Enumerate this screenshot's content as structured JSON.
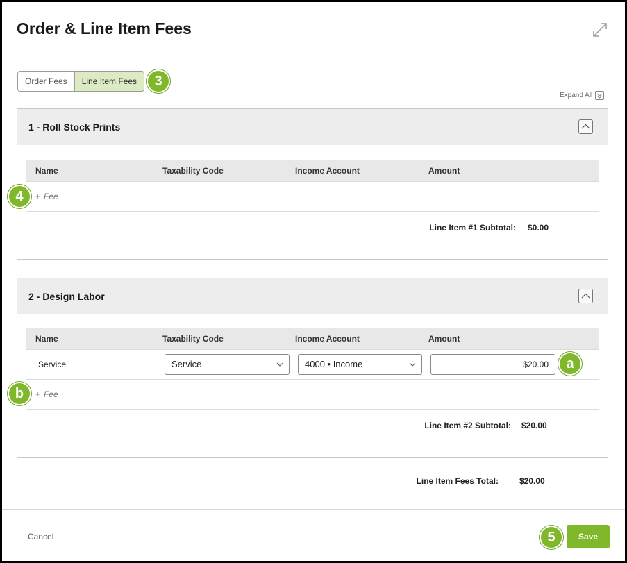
{
  "dialog": {
    "title": "Order & Line Item Fees"
  },
  "tabs": {
    "order_fees": "Order Fees",
    "line_item_fees": "Line Item Fees",
    "active": "Line Item Fees"
  },
  "expand_all": "Expand All",
  "callouts": {
    "tabs": "3",
    "add_fee_1": "4",
    "amount": "a",
    "add_fee_2": "b",
    "save": "5"
  },
  "columns": [
    "Name",
    "Taxability Code",
    "Income Account",
    "Amount"
  ],
  "line_items": [
    {
      "title": "1 - Roll Stock Prints",
      "rows": [],
      "add_fee_label": "Fee",
      "subtotal_label": "Line Item #1 Subtotal:",
      "subtotal_value": "$0.00"
    },
    {
      "title": "2 - Design Labor",
      "rows": [
        {
          "name": "Service",
          "taxability_code": "Service",
          "income_account": "4000 • Income",
          "amount": "$20.00"
        }
      ],
      "add_fee_label": "Fee",
      "subtotal_label": "Line Item #2 Subtotal:",
      "subtotal_value": "$20.00"
    }
  ],
  "total": {
    "label": "Line Item Fees Total:",
    "value": "$20.00"
  },
  "footer": {
    "cancel_label": "Cancel",
    "save_label": "Save"
  },
  "colors": {
    "accent_green": "#7fb82b",
    "active_tab_bg": "#dcebc3",
    "panel_header_bg": "#ededed",
    "table_header_bg": "#e8e8e8"
  }
}
